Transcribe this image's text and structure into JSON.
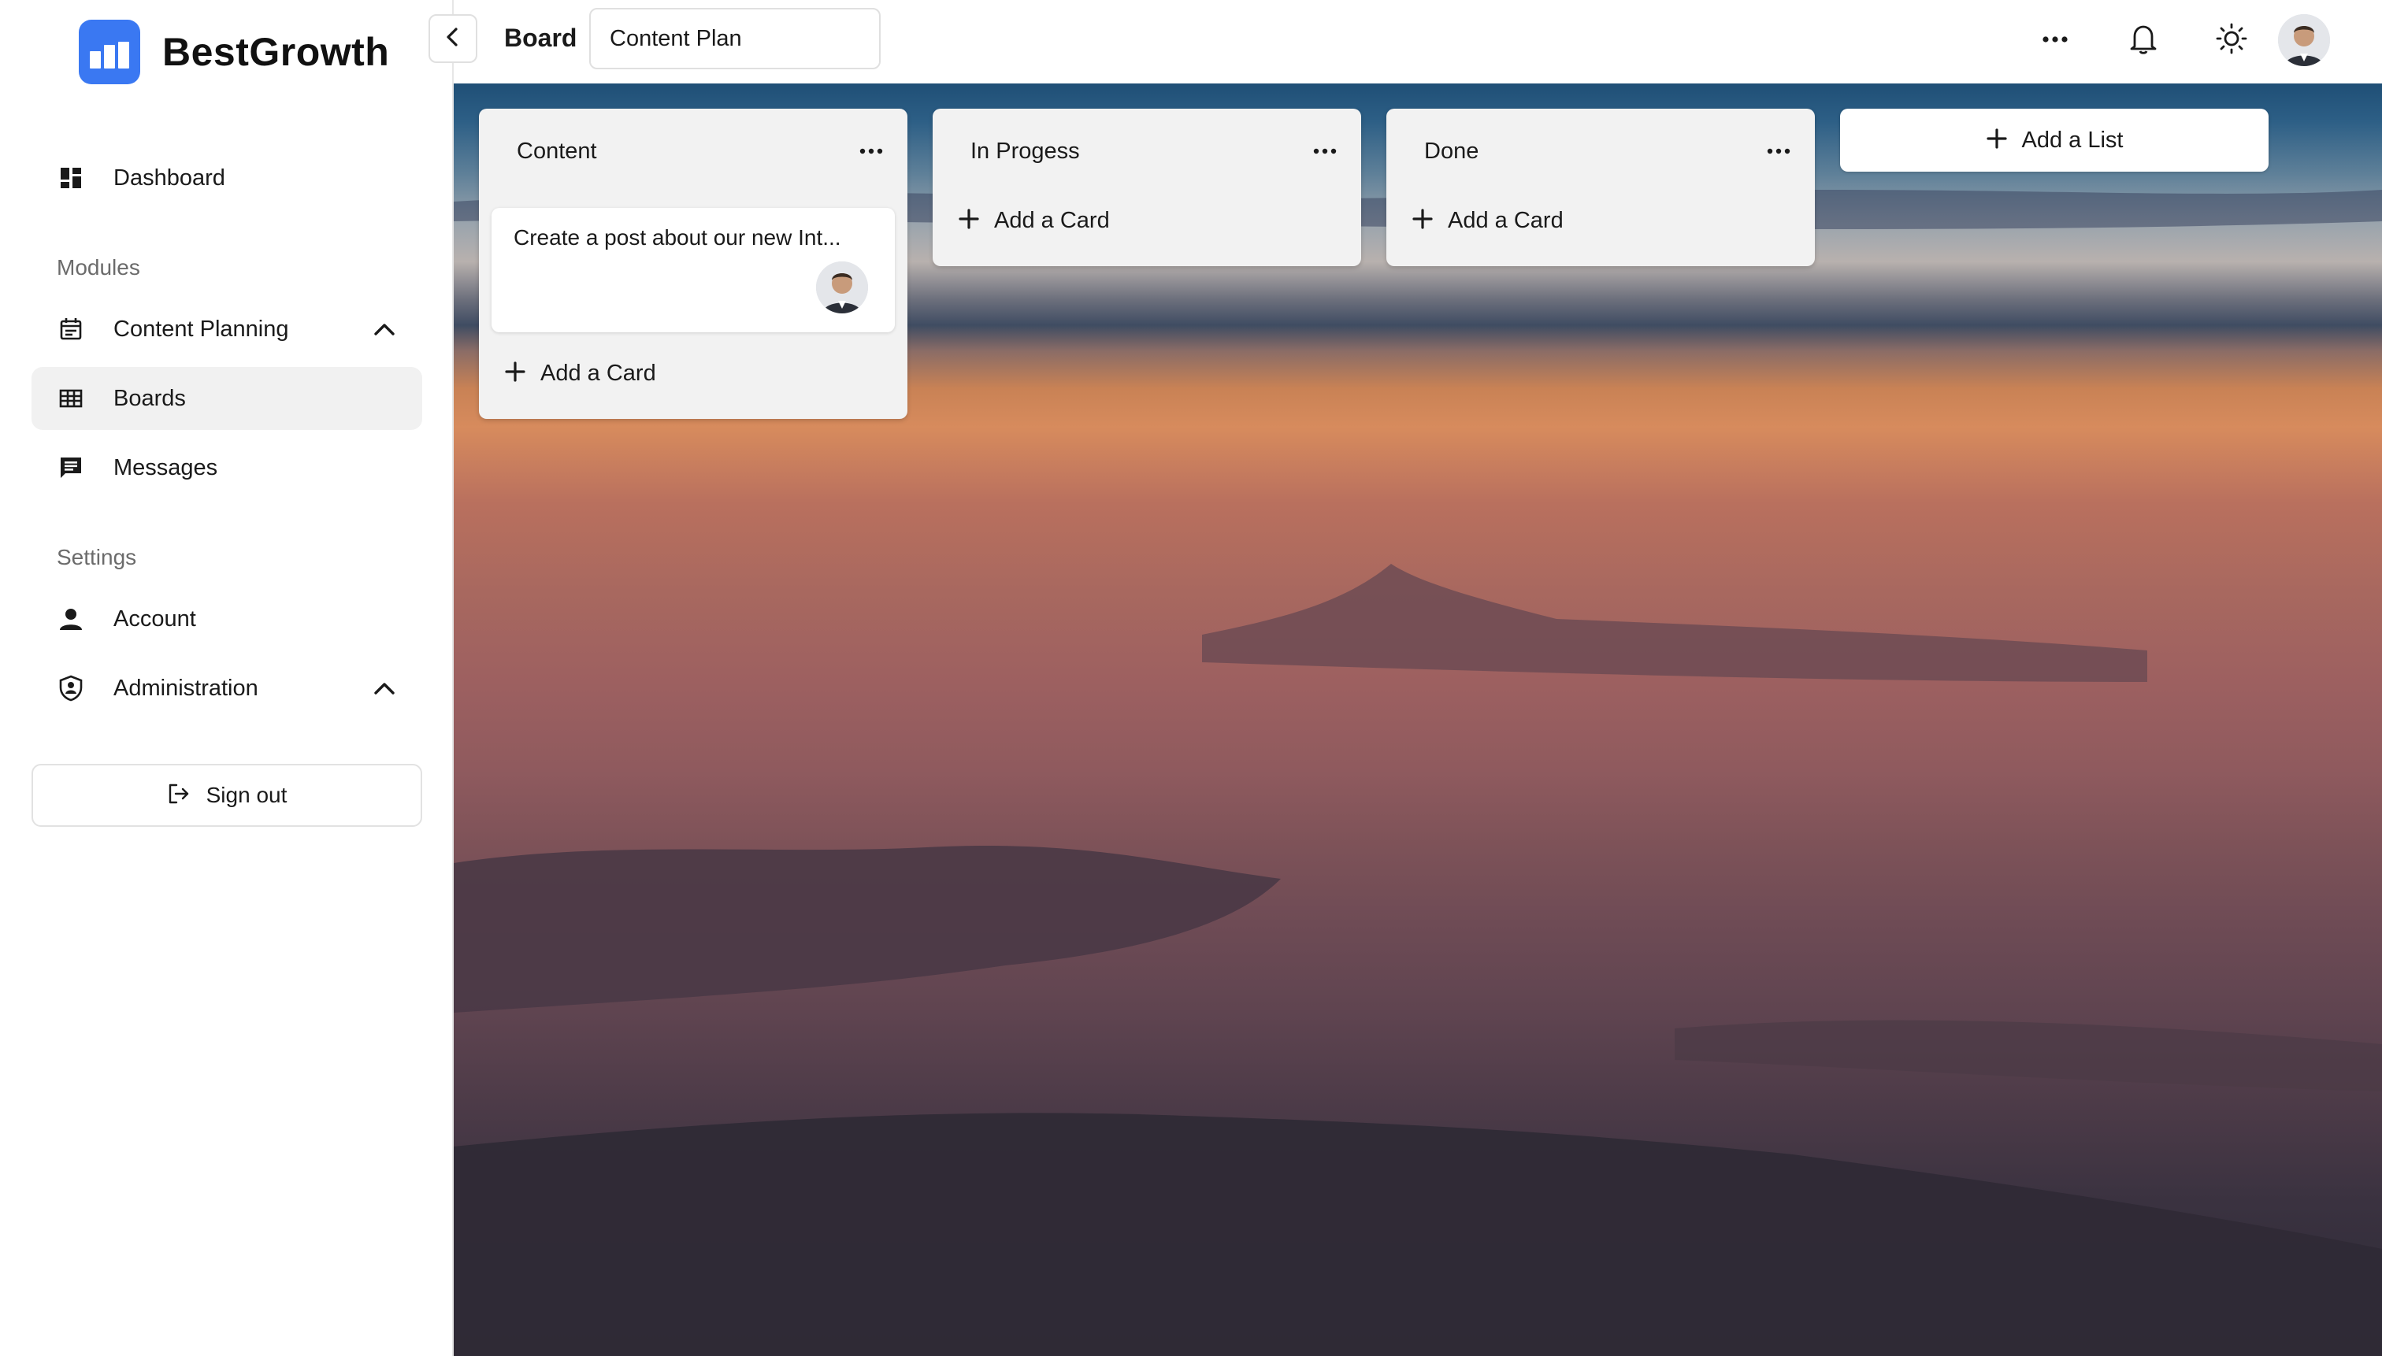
{
  "brand": {
    "name": "BestGrowth",
    "logo_icon": "bar-chart-logo-icon",
    "accent": "#3a78f2"
  },
  "sidebar": {
    "dashboard": {
      "label": "Dashboard",
      "icon": "dashboard-icon"
    },
    "modules_heading": "Modules",
    "content_planning": {
      "label": "Content Planning",
      "icon": "calendar-icon",
      "expanded": true
    },
    "boards": {
      "label": "Boards",
      "icon": "grid-icon",
      "active": true
    },
    "messages": {
      "label": "Messages",
      "icon": "message-icon"
    },
    "settings_heading": "Settings",
    "account": {
      "label": "Account",
      "icon": "person-icon"
    },
    "administration": {
      "label": "Administration",
      "icon": "shield-icon",
      "expanded": true
    },
    "sign_out": {
      "label": "Sign out",
      "icon": "logout-icon"
    }
  },
  "topbar": {
    "breadcrumb": "Board",
    "board_name": "Content Plan",
    "icons": [
      "more-horizontal-icon",
      "bell-icon",
      "sun-icon",
      "user-avatar"
    ]
  },
  "board": {
    "lists": [
      {
        "title": "Content",
        "cards": [
          {
            "text": "Create a post about our new Int...",
            "assignee_avatar": true
          }
        ],
        "add_card_label": "Add a Card"
      },
      {
        "title": "In Progess",
        "cards": [],
        "add_card_label": "Add a Card"
      },
      {
        "title": "Done",
        "cards": [],
        "add_card_label": "Add a Card"
      }
    ],
    "add_list_label": "Add a List"
  }
}
